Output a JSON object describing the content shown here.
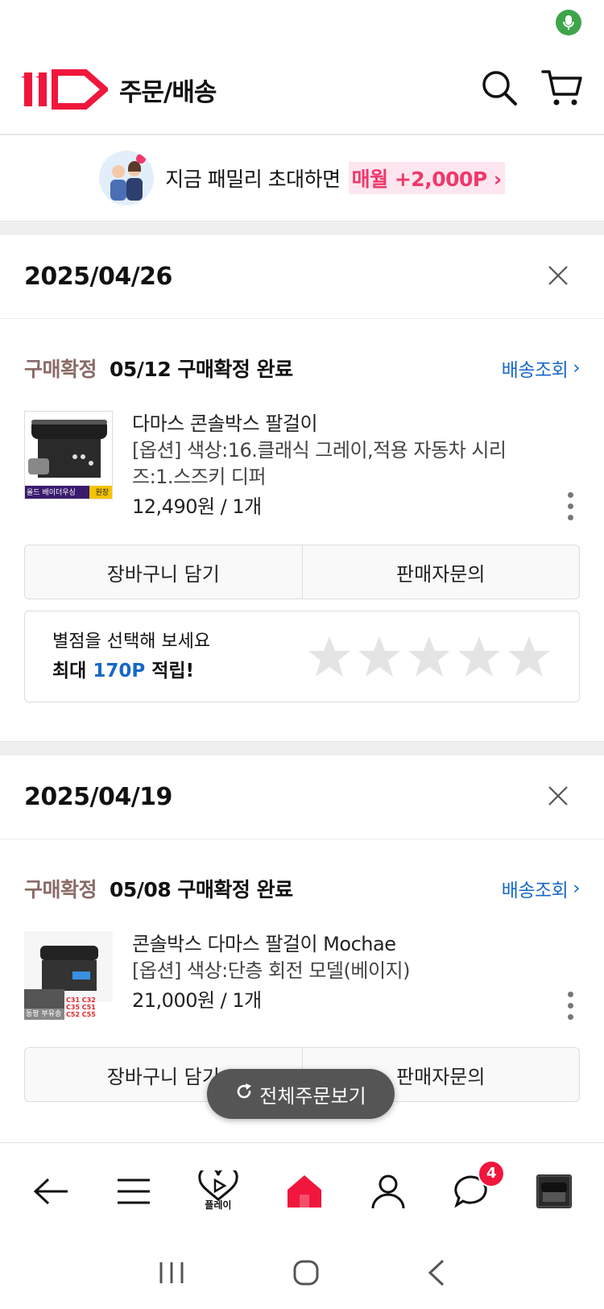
{
  "header": {
    "title": "주문/배송"
  },
  "promo": {
    "text": "지금 패밀리 초대하면",
    "highlight": "매월 +2,000P"
  },
  "orders": [
    {
      "date": "2025/04/26",
      "status_label": "구매확정",
      "status_text": "05/12 구매확정 완료",
      "track_label": "배송조회",
      "product_name": "다마스 콘솔박스 팔걸이",
      "product_option_1": "[옵션] 색상:16.클래식 그레이,적용 자동차 시리",
      "product_option_2": "즈:1.스즈키 디퍼",
      "price": "12,490원 / 1개",
      "thumb_tag_left": "올드 베이더우싱",
      "thumb_tag_right": "원장",
      "cart_button": "장바구니 담기",
      "inquiry_button": "판매자문의"
    },
    {
      "date": "2025/04/19",
      "status_label": "구매확정",
      "status_text": "05/08 구매확정 완료",
      "track_label": "배송조회",
      "product_name": "콘솔박스 다마스 팔걸이 Mochae",
      "product_option_1": "[옵션] 색상:단층 회전 모델(베이지)",
      "price": "21,000원 / 1개",
      "thumb_tag_left": "동팡 부유송",
      "thumb_tag_right": "C31 C32 C35 C51 C52 C55",
      "cart_button": "장바구니 담기",
      "inquiry_button": "판매자문의"
    }
  ],
  "review": {
    "prompt": "별점을 선택해 보세요",
    "points_prefix": "최대",
    "points_value": "170P",
    "points_suffix": "적립!",
    "rating": 0,
    "max_rating": 5
  },
  "fab": {
    "label": "전체주문보기"
  },
  "bottom_nav": {
    "play_label": "플레이",
    "chat_badge": "4"
  },
  "colors": {
    "brand_red": "#f0163c",
    "link_blue": "#1668c7",
    "status_brown": "#8a6a66",
    "promo_pink": "#f0386b"
  }
}
